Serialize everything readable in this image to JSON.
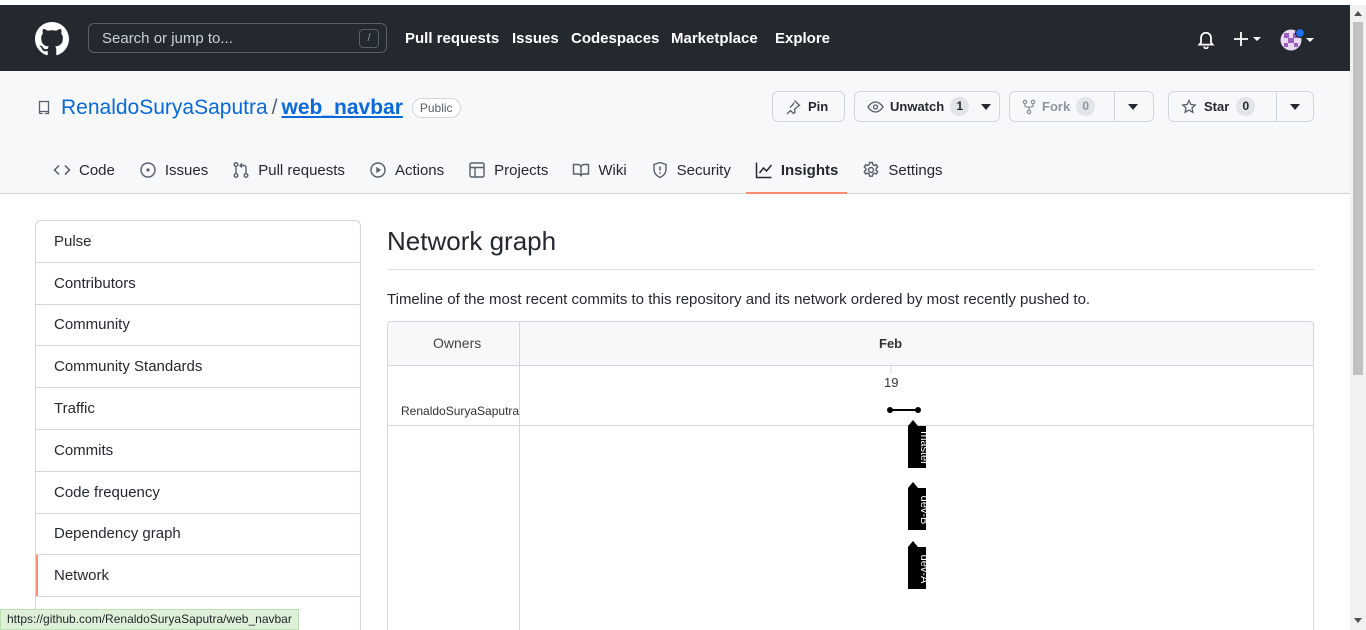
{
  "header": {
    "search_placeholder": "Search or jump to...",
    "search_shortcut": "/",
    "nav": [
      "Pull requests",
      "Issues",
      "Codespaces",
      "Marketplace",
      "Explore"
    ]
  },
  "repo": {
    "owner": "RenaldoSuryaSaputra",
    "separator": "/",
    "name": "web_navbar",
    "visibility": "Public",
    "pin_label": "Pin",
    "unwatch_label": "Unwatch",
    "watch_count": "1",
    "fork_label": "Fork",
    "fork_count": "0",
    "star_label": "Star",
    "star_count": "0"
  },
  "tabs": [
    {
      "label": "Code",
      "icon": "code-icon"
    },
    {
      "label": "Issues",
      "icon": "issue-icon"
    },
    {
      "label": "Pull requests",
      "icon": "pull-request-icon"
    },
    {
      "label": "Actions",
      "icon": "play-icon"
    },
    {
      "label": "Projects",
      "icon": "table-icon"
    },
    {
      "label": "Wiki",
      "icon": "book-icon"
    },
    {
      "label": "Security",
      "icon": "shield-icon"
    },
    {
      "label": "Insights",
      "icon": "graph-icon",
      "active": true
    },
    {
      "label": "Settings",
      "icon": "gear-icon"
    }
  ],
  "sidebar": {
    "items": [
      "Pulse",
      "Contributors",
      "Community",
      "Community Standards",
      "Traffic",
      "Commits",
      "Code frequency",
      "Dependency graph",
      "Network"
    ],
    "active": "Network"
  },
  "main": {
    "title": "Network graph",
    "description": "Timeline of the most recent commits to this repository and its network ordered by most recently pushed to."
  },
  "network": {
    "owners_label": "Owners",
    "month": "Feb",
    "day": "19",
    "owner": "RenaldoSuryaSaputra",
    "branches": [
      "master",
      "dev-B",
      "dev-A"
    ]
  },
  "statusbar": {
    "url": "https://github.com/RenaldoSuryaSaputra/web_navbar"
  },
  "colors": {
    "header_bg": "#24292f",
    "link": "#0969da",
    "active_underline": "#fd8c73",
    "branch_label_bg": "#000000"
  }
}
